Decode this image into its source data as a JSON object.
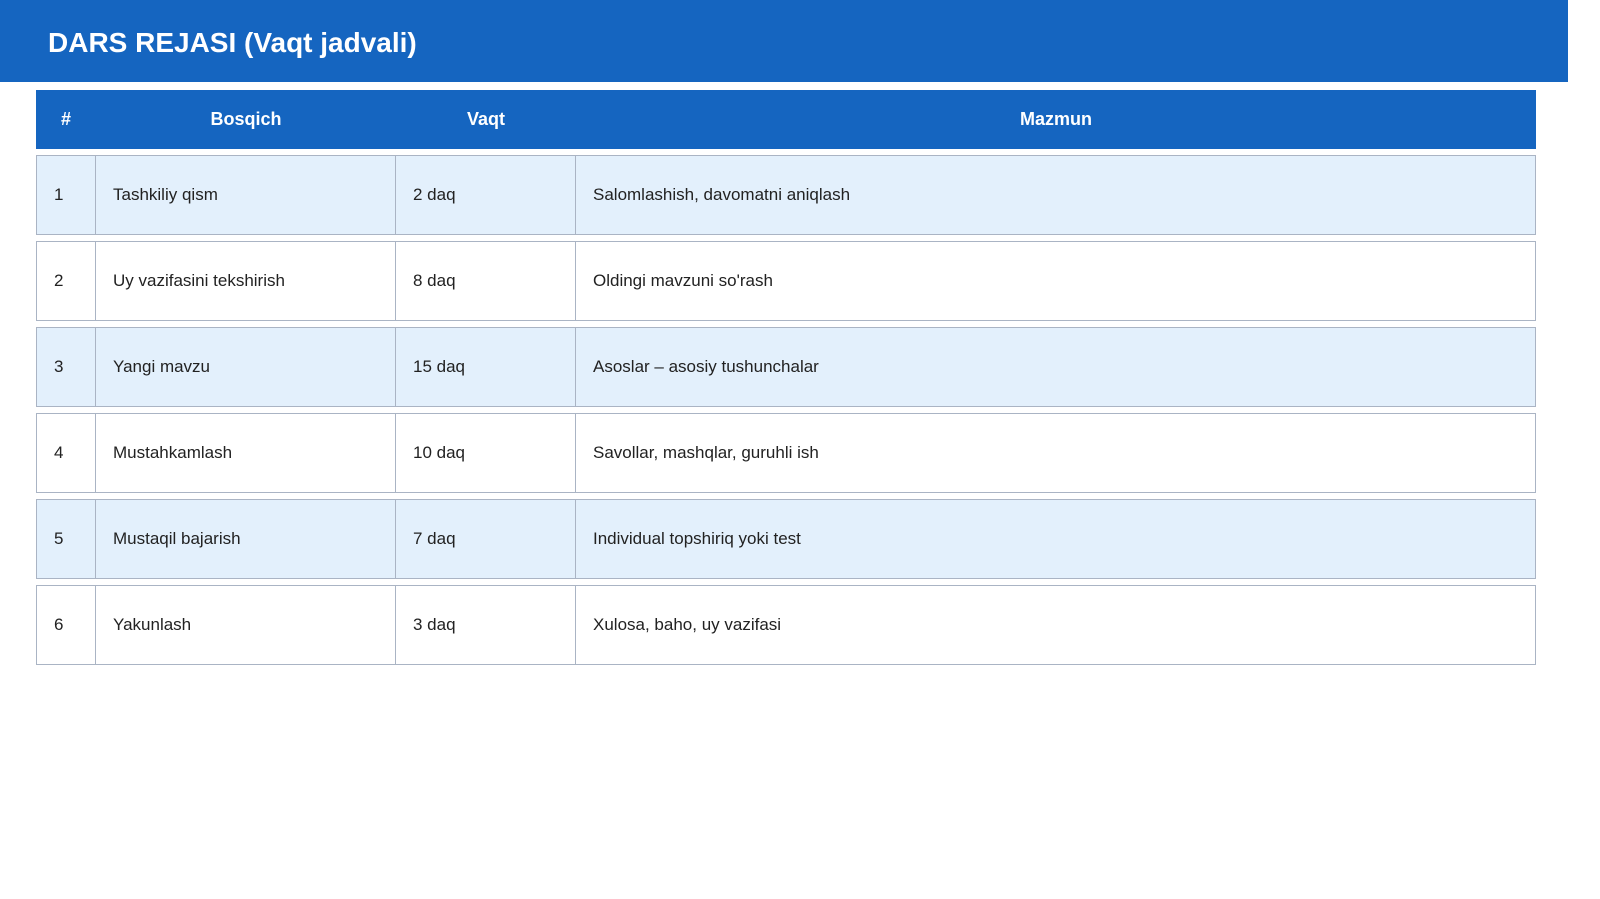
{
  "title": "DARS REJASI (Vaqt jadvali)",
  "table": {
    "headers": [
      "#",
      "Bosqich",
      "Vaqt",
      "Mazmun"
    ],
    "rows": [
      {
        "num": "1",
        "step": "Tashkiliy qism",
        "time": "2 daq",
        "content": "Salomlashish, davomatni aniqlash"
      },
      {
        "num": "2",
        "step": "Uy vazifasini tekshirish",
        "time": "8 daq",
        "content": "Oldingi mavzuni so'rash"
      },
      {
        "num": "3",
        "step": "Yangi mavzu",
        "time": "15 daq",
        "content": "Asoslar – asosiy tushunchalar"
      },
      {
        "num": "4",
        "step": "Mustahkamlash",
        "time": "10 daq",
        "content": "Savollar, mashqlar, guruhli ish"
      },
      {
        "num": "5",
        "step": "Mustaqil bajarish",
        "time": "7 daq",
        "content": "Individual topshiriq yoki test"
      },
      {
        "num": "6",
        "step": "Yakunlash",
        "time": "3 daq",
        "content": "Xulosa, baho, uy vazifasi"
      }
    ]
  },
  "colors": {
    "header_blue": "#1565c0",
    "row_shade": "#e3f0fc",
    "border": "#aab4c4"
  }
}
